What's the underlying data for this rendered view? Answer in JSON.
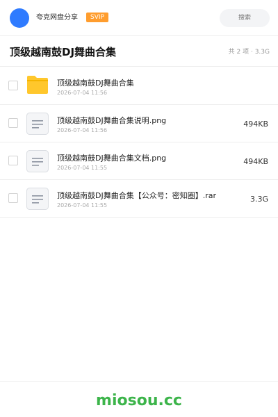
{
  "header": {
    "app_name": "夸克网盘分享",
    "badge": "SVIP",
    "search_placeholder": "搜索"
  },
  "folder": {
    "title": "顶级越南鼓DJ舞曲合集",
    "summary": "共 2 项 · 3.3G"
  },
  "files": [
    {
      "icon": "folder-icon",
      "name": "顶级越南鼓DJ舞曲合集",
      "date": "2026-07-04 11:56",
      "size": ""
    },
    {
      "icon": "document-icon",
      "name": "顶级越南鼓DJ舞曲合集说明.png",
      "date": "2026-07-04 11:56",
      "size": "494KB"
    },
    {
      "icon": "document-icon",
      "name": "顶级越南鼓DJ舞曲合集文档.png",
      "date": "2026-07-04 11:55",
      "size": "494KB"
    },
    {
      "icon": "document-icon",
      "name": "顶级越南鼓DJ舞曲合集【公众号：密知圈】.rar",
      "date": "2026-07-04 11:55",
      "size": "3.3G"
    }
  ],
  "footer": {
    "watermark": "miosou.cc"
  },
  "colors": {
    "avatar": "#2f7bff",
    "badge": "#ff9d2e",
    "folder": "#ffc72c",
    "watermark": "#3cb44a"
  }
}
